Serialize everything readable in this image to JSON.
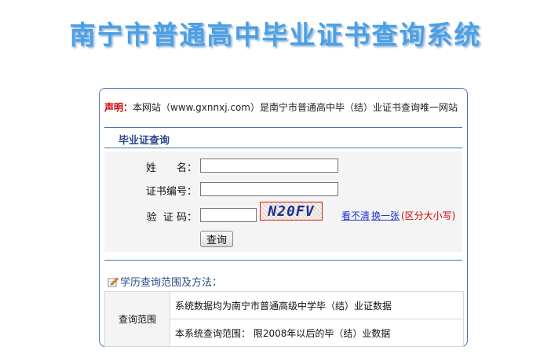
{
  "header": {
    "title": "南宁市普通高中毕业证书查询系统"
  },
  "notice": {
    "label": "声明：",
    "text": "本网站（www.gxnnxj.com）是南宁市普通高中毕（结）业证书查询唯一网站"
  },
  "section": {
    "title": "毕业证查询"
  },
  "form": {
    "name_label": "姓　　名：",
    "name_value": "",
    "cert_label": "证书编号：",
    "cert_value": "",
    "captcha_label": "验  证 码：",
    "captcha_value": "",
    "captcha_image_text": "N20FV",
    "refresh_link_1": "看不清",
    "refresh_link_2": "换一张",
    "case_note": "(区分大小写)",
    "submit_label": "查询"
  },
  "method": {
    "heading": "学历查询范围及方法：",
    "table_header": "查询范围",
    "rows": [
      "系统数据均为南宁市普通高级中学毕（结）业证数据",
      "本系统查询范围： 限2008年以后的毕（结）业数据"
    ]
  },
  "colors": {
    "title": "#4aa0e6",
    "border": "#4a73b5",
    "notice_label": "#cc0000",
    "link": "#1a33cc"
  },
  "icons": {
    "method": "pencil-note-icon"
  }
}
